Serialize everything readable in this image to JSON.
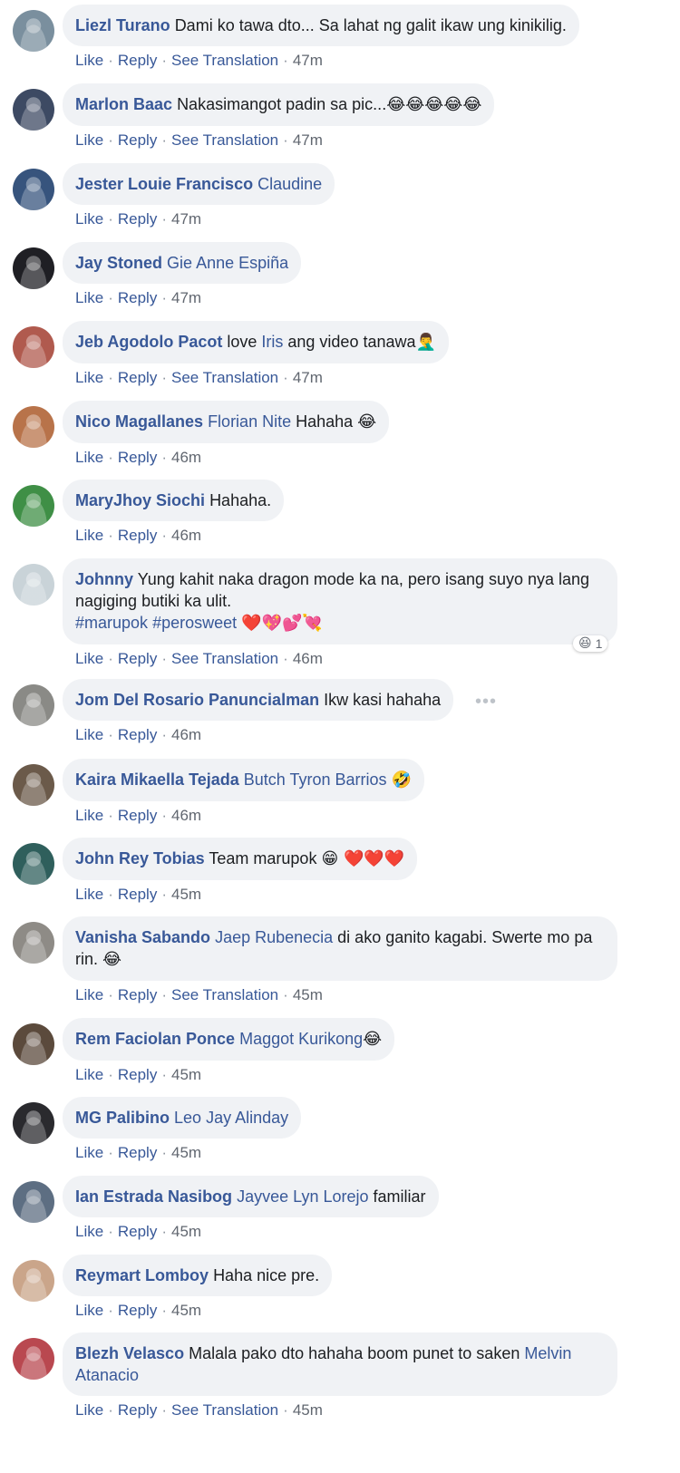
{
  "action_labels": {
    "like": "Like",
    "reply": "Reply",
    "see_translation": "See Translation"
  },
  "comments": [
    {
      "author": "Liezl Turano",
      "parts": [
        {
          "type": "text",
          "text": "Dami ko tawa dto... Sa lahat ng galit ikaw ung kinikilig."
        }
      ],
      "time": "47m",
      "see_translation": true,
      "avatar_color": "#7a8f9e"
    },
    {
      "author": "Marlon Baac",
      "parts": [
        {
          "type": "text",
          "text": "Nakasimangot padin sa pic..."
        },
        {
          "type": "emoji",
          "text": "😂😂😂😂😂"
        }
      ],
      "time": "47m",
      "see_translation": true,
      "avatar_color": "#3d4a63"
    },
    {
      "author": "Jester Louie Francisco",
      "parts": [
        {
          "type": "mention",
          "text": "Claudine"
        }
      ],
      "time": "47m",
      "see_translation": false,
      "avatar_color": "#37547d"
    },
    {
      "author": "Jay Stoned",
      "parts": [
        {
          "type": "mention",
          "text": "Gie Anne Espiña"
        }
      ],
      "time": "47m",
      "see_translation": false,
      "avatar_color": "#1f1f24"
    },
    {
      "author": "Jeb Agodolo Pacot",
      "parts": [
        {
          "type": "text",
          "text": "love "
        },
        {
          "type": "mention",
          "text": "Iris"
        },
        {
          "type": "text",
          "text": " ang video tanawa"
        },
        {
          "type": "emoji",
          "text": "🤦‍♂️"
        }
      ],
      "time": "47m",
      "see_translation": true,
      "avatar_color": "#b05a4e"
    },
    {
      "author": "Nico Magallanes",
      "parts": [
        {
          "type": "mention",
          "text": "Florian Nite"
        },
        {
          "type": "text",
          "text": " Hahaha "
        },
        {
          "type": "emoji",
          "text": "😂"
        }
      ],
      "time": "46m",
      "see_translation": false,
      "avatar_color": "#b8734a"
    },
    {
      "author": "MaryJhoy Siochi",
      "parts": [
        {
          "type": "text",
          "text": "Hahaha."
        }
      ],
      "time": "46m",
      "see_translation": false,
      "avatar_color": "#3f8f46"
    },
    {
      "author": "Johnny",
      "parts": [
        {
          "type": "text",
          "text": "Yung kahit naka dragon mode ka na, pero isang suyo nya lang nagiging butiki ka ulit."
        },
        {
          "type": "break"
        },
        {
          "type": "hashtag",
          "text": "#marupok"
        },
        {
          "type": "text",
          "text": " "
        },
        {
          "type": "hashtag",
          "text": "#perosweet"
        },
        {
          "type": "text",
          "text": " "
        },
        {
          "type": "emoji",
          "text": "❤️💖💕💘"
        }
      ],
      "time": "46m",
      "see_translation": true,
      "avatar_color": "#c9d3d8",
      "reaction": {
        "emoji": "😆",
        "count": "1"
      }
    },
    {
      "author": "Jom Del Rosario Panuncialman",
      "parts": [
        {
          "type": "text",
          "text": "Ikw kasi hahaha"
        }
      ],
      "time": "46m",
      "see_translation": false,
      "avatar_color": "#8a8a86",
      "more": "•••"
    },
    {
      "author": "Kaira Mikaella Tejada",
      "parts": [
        {
          "type": "mention",
          "text": "Butch Tyron Barrios"
        },
        {
          "type": "text",
          "text": " "
        },
        {
          "type": "emoji",
          "text": "🤣"
        }
      ],
      "time": "46m",
      "see_translation": false,
      "avatar_color": "#6b5a4a"
    },
    {
      "author": "John Rey Tobias",
      "parts": [
        {
          "type": "text",
          "text": "Team marupok "
        },
        {
          "type": "emoji",
          "text": "😁 ❤️❤️❤️"
        }
      ],
      "time": "45m",
      "see_translation": false,
      "avatar_color": "#2f5f5c"
    },
    {
      "author": "Vanisha Sabando",
      "parts": [
        {
          "type": "mention",
          "text": "Jaep Rubenecia"
        },
        {
          "type": "text",
          "text": " di ako ganito kagabi. Swerte mo pa rin. "
        },
        {
          "type": "emoji",
          "text": "😂"
        }
      ],
      "time": "45m",
      "see_translation": true,
      "avatar_color": "#8e8b86"
    },
    {
      "author": "Rem Faciolan Ponce",
      "parts": [
        {
          "type": "mention",
          "text": "Maggot Kurikong"
        },
        {
          "type": "emoji",
          "text": "😂"
        }
      ],
      "time": "45m",
      "see_translation": false,
      "avatar_color": "#5b4a3c"
    },
    {
      "author": "MG Palibino",
      "parts": [
        {
          "type": "mention",
          "text": "Leo Jay Alinday"
        }
      ],
      "time": "45m",
      "see_translation": false,
      "avatar_color": "#2a2a2e"
    },
    {
      "author": "Ian Estrada Nasibog",
      "parts": [
        {
          "type": "mention",
          "text": "Jayvee Lyn Lorejo"
        },
        {
          "type": "text",
          "text": " familiar"
        }
      ],
      "time": "45m",
      "see_translation": false,
      "avatar_color": "#5d6e82"
    },
    {
      "author": "Reymart Lomboy",
      "parts": [
        {
          "type": "text",
          "text": "Haha nice pre."
        }
      ],
      "time": "45m",
      "see_translation": false,
      "avatar_color": "#caa58a"
    },
    {
      "author": "Blezh Velasco",
      "parts": [
        {
          "type": "text",
          "text": "Malala pako dto hahaha boom punet to saken "
        },
        {
          "type": "mention",
          "text": "Melvin Atanacio"
        }
      ],
      "time": "45m",
      "see_translation": true,
      "avatar_color": "#b94850"
    }
  ]
}
